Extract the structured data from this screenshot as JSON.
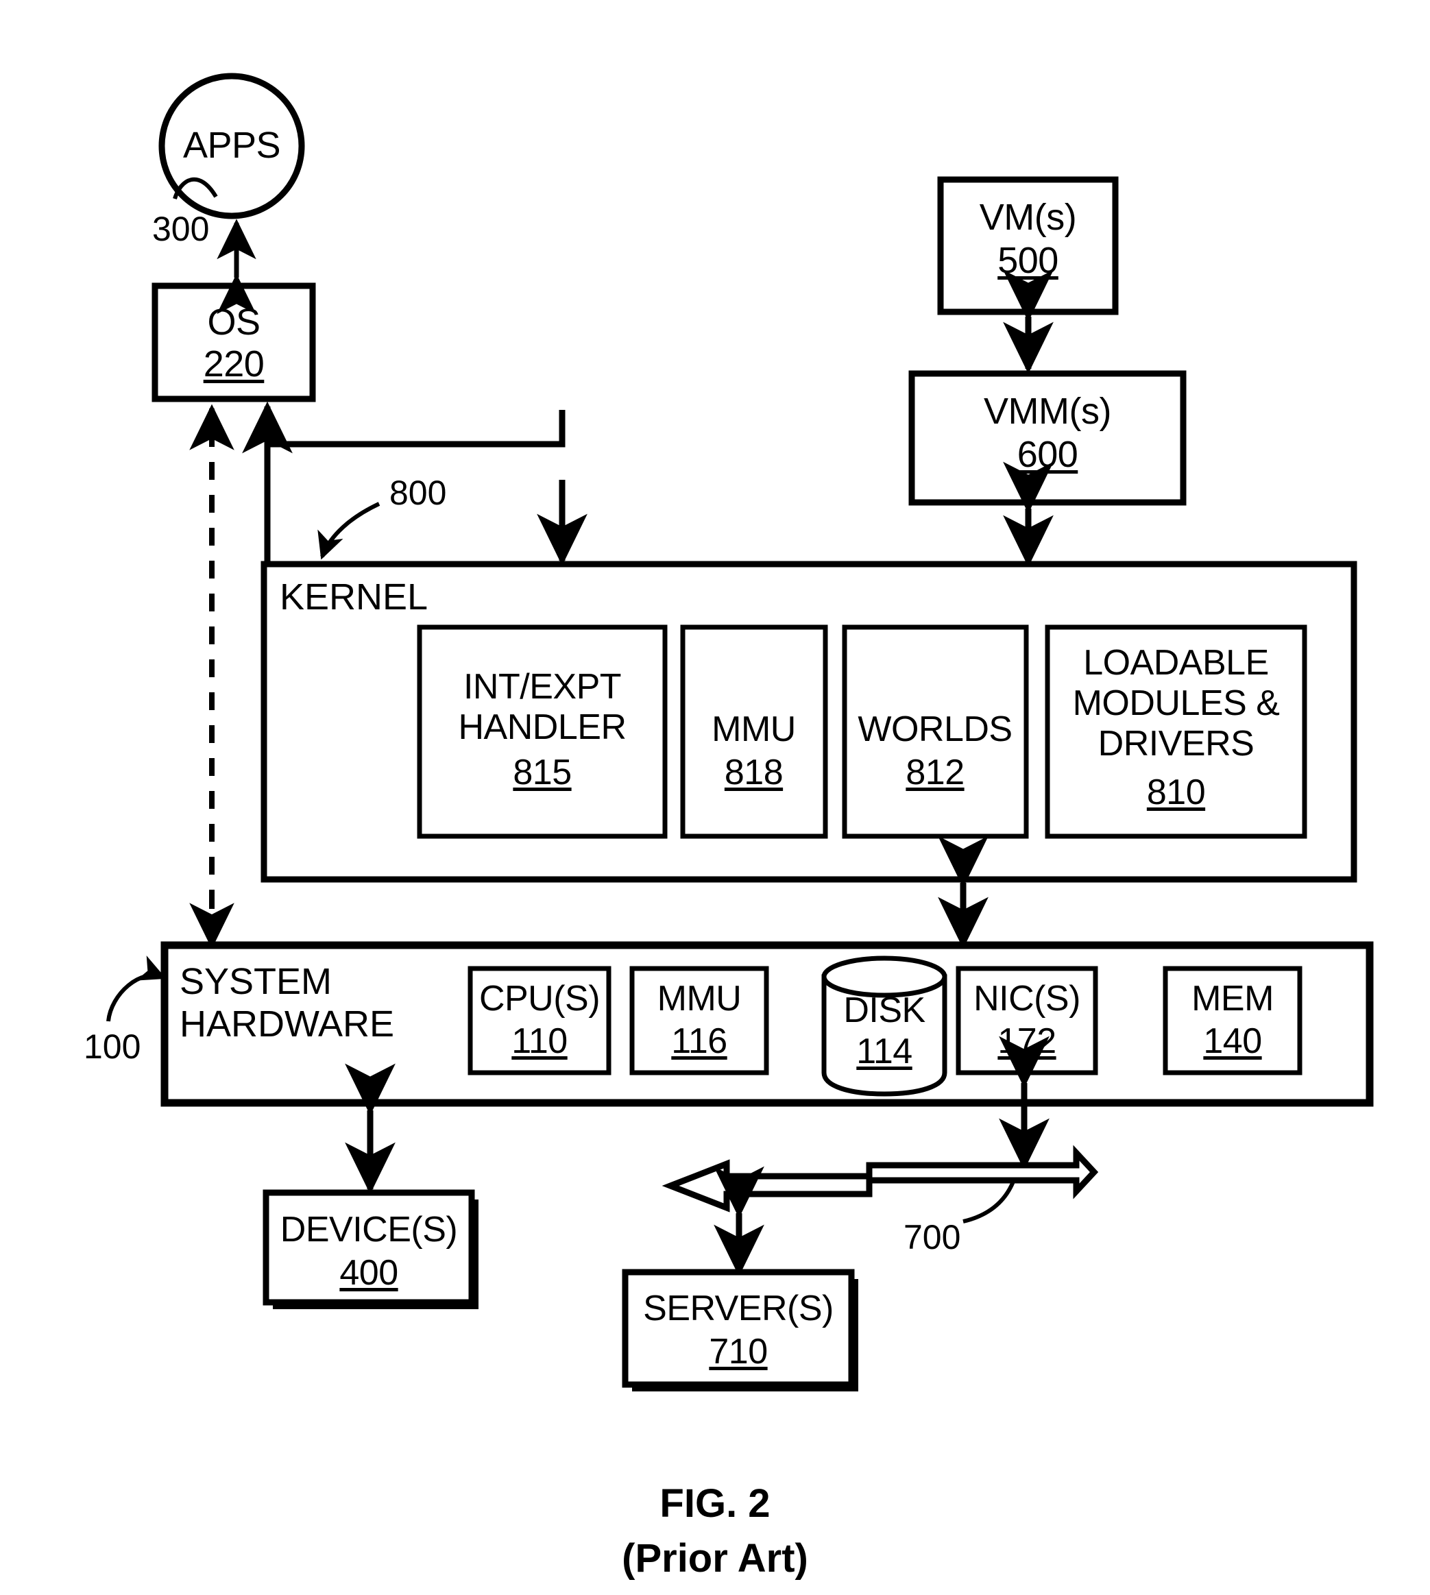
{
  "figure": {
    "caption_line1": "FIG.  2",
    "caption_line2": "(Prior Art)",
    "stroke_color": "#000000",
    "background_color": "#ffffff"
  },
  "nodes": {
    "apps": {
      "label": "APPS",
      "ref": "300",
      "shape": "circle"
    },
    "os": {
      "label": "OS",
      "num": "220",
      "shape": "rect"
    },
    "vm": {
      "label": "VM(s)",
      "num": "500",
      "shape": "rect"
    },
    "vmm": {
      "label": "VMM(s)",
      "num": "600",
      "shape": "rect"
    },
    "kernel": {
      "label": "KERNEL",
      "ref": "800",
      "shape": "rect"
    },
    "int_expt_handler": {
      "label": "INT/EXPT\nHANDLER",
      "num": "815",
      "shape": "rect"
    },
    "kernel_mmu": {
      "label": "MMU",
      "num": "818",
      "shape": "rect"
    },
    "worlds": {
      "label": "WORLDS",
      "num": "812",
      "shape": "rect"
    },
    "loadable_modules": {
      "label": "LOADABLE\nMODULES &\nDRIVERS",
      "num": "810",
      "shape": "rect"
    },
    "system_hardware": {
      "label": "SYSTEM\nHARDWARE",
      "ref": "100",
      "shape": "rect"
    },
    "cpus": {
      "label": "CPU(S)",
      "num": "110",
      "shape": "rect"
    },
    "hw_mmu": {
      "label": "MMU",
      "num": "116",
      "shape": "rect"
    },
    "disk": {
      "label": "DISK",
      "num": "114",
      "shape": "cylinder"
    },
    "nics": {
      "label": "NIC(S)",
      "num": "172",
      "shape": "rect"
    },
    "mem": {
      "label": "MEM",
      "num": "140",
      "shape": "rect"
    },
    "devices": {
      "label": "DEVICE(S)",
      "num": "400",
      "shape": "rect-shadow"
    },
    "servers": {
      "label": "SERVER(S)",
      "num": "710",
      "shape": "rect-shadow"
    },
    "network": {
      "ref": "700",
      "shape": "hollow-double-arrow"
    }
  },
  "connections": [
    {
      "from": "apps",
      "to": "os",
      "style": "double-arrow-solid"
    },
    {
      "from": "system_hardware",
      "to": "os",
      "style": "single-arrow-dashed"
    },
    {
      "from": "kernel",
      "to": "os",
      "style": "elbow-double-arrow-solid"
    },
    {
      "from": "vm",
      "to": "vmm",
      "style": "double-arrow-solid"
    },
    {
      "from": "vmm",
      "to": "kernel",
      "style": "double-arrow-solid"
    },
    {
      "from": "kernel",
      "to": "system_hardware",
      "style": "double-arrow-solid"
    },
    {
      "from": "system_hardware",
      "to": "devices",
      "style": "double-arrow-solid"
    },
    {
      "from": "nics",
      "to": "network",
      "style": "double-arrow-solid"
    },
    {
      "from": "network",
      "to": "servers",
      "style": "double-arrow-solid"
    }
  ]
}
